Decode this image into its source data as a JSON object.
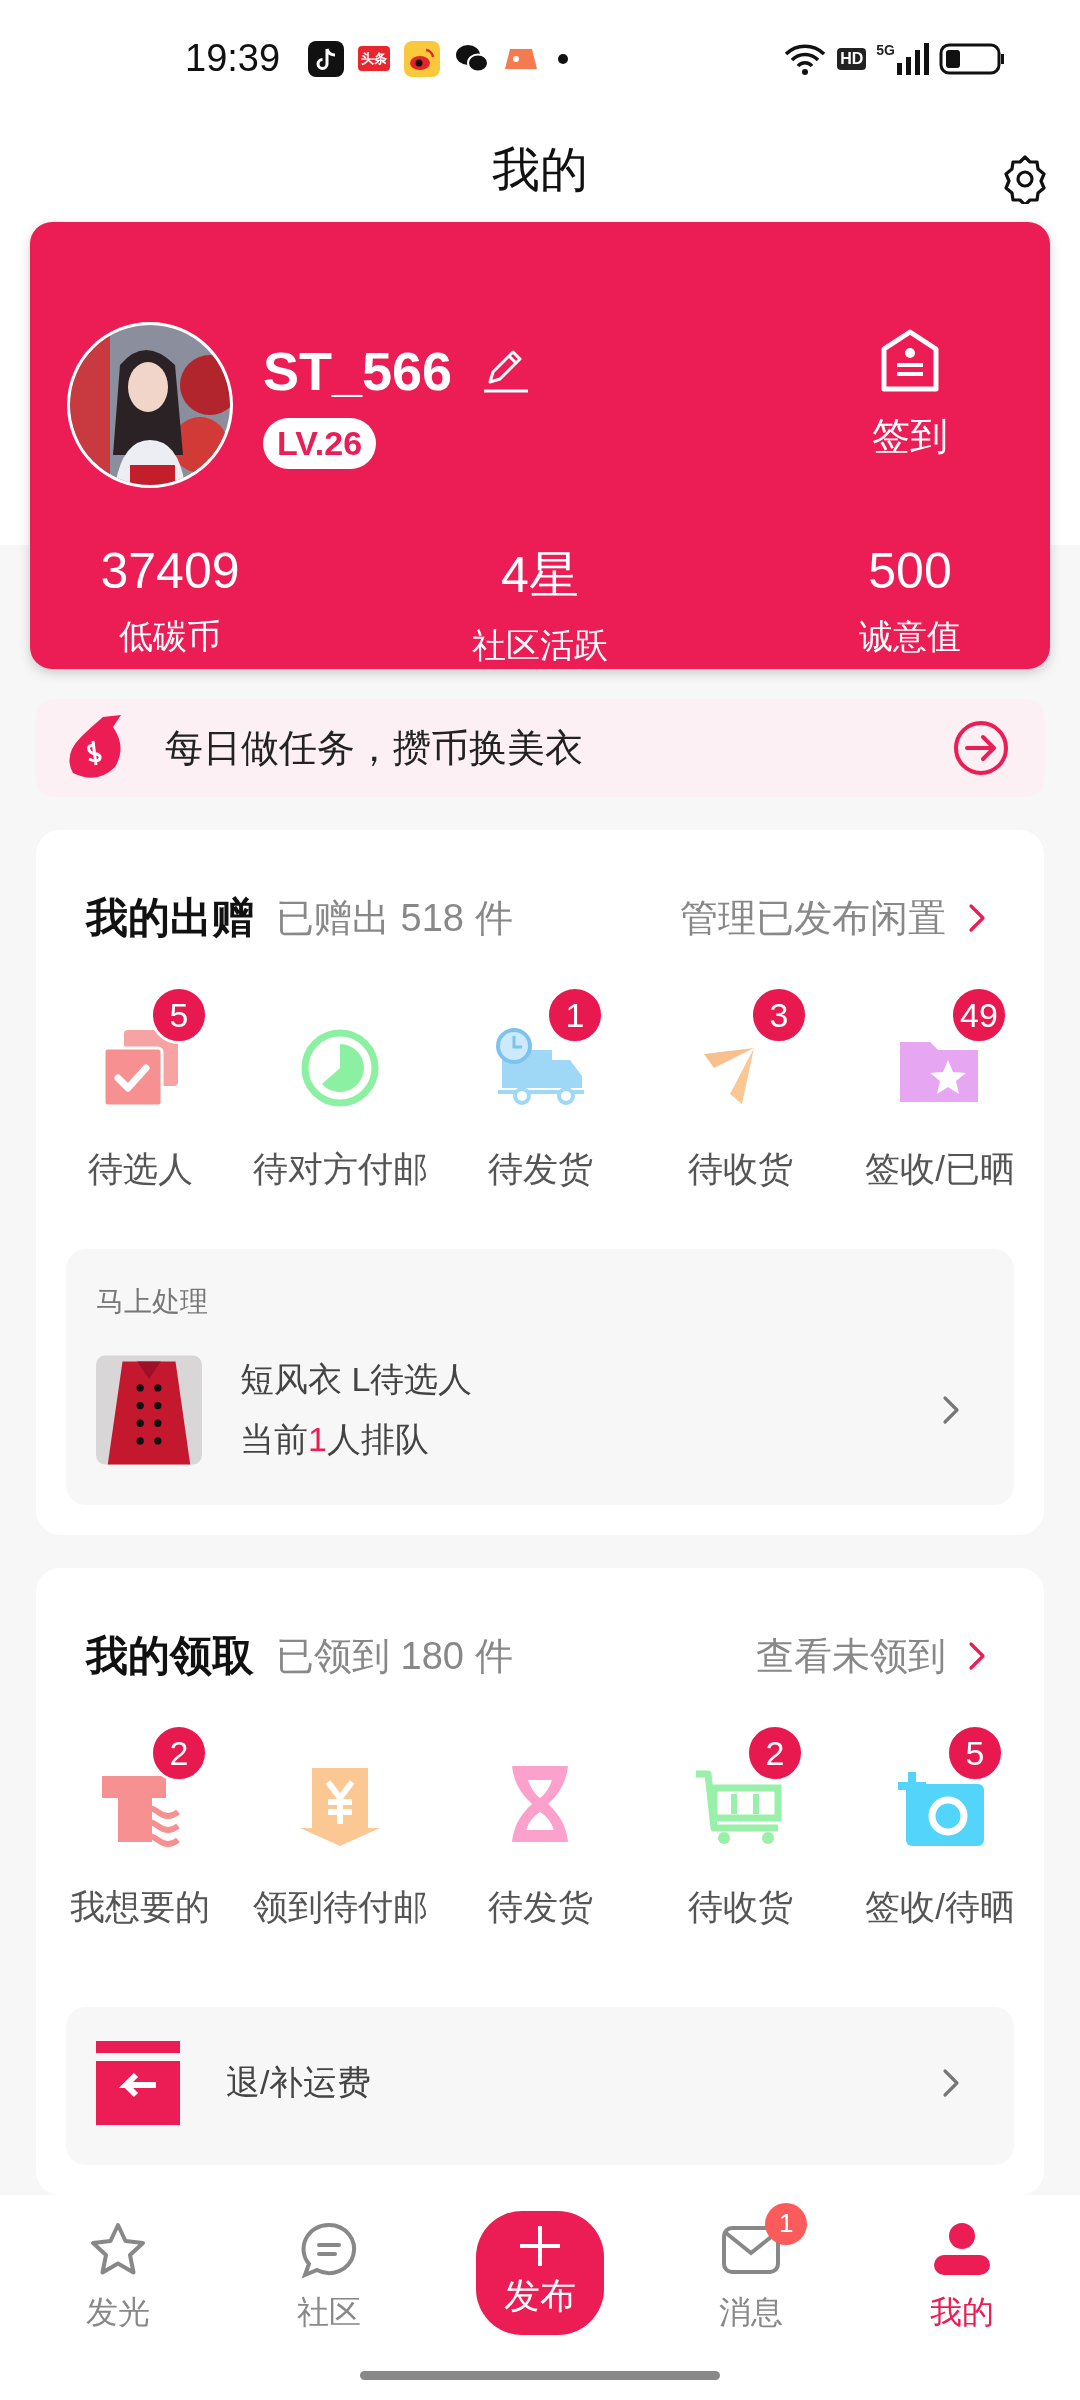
{
  "status_bar": {
    "time": "19:39",
    "news_app_label": "头条",
    "hd_badge": "HD",
    "network_type": "5G"
  },
  "header": {
    "title": "我的"
  },
  "profile": {
    "username": "ST_566",
    "level": "LV.26",
    "checkin_label": "签到",
    "stats": [
      {
        "value": "37409",
        "label": "低碳币"
      },
      {
        "value": "4星",
        "label": "社区活跃"
      },
      {
        "value": "500",
        "label": "诚意值"
      }
    ]
  },
  "banner": {
    "text": "每日做任务，攒币换美衣"
  },
  "sections": [
    {
      "title": "我的出赠",
      "summary": "已赠出 518 件",
      "link": "管理已发布闲置",
      "items": [
        {
          "kind": "clipboard",
          "label": "待选人",
          "badge": "5"
        },
        {
          "kind": "clock",
          "label": "待对方付邮"
        },
        {
          "kind": "truck",
          "label": "待发货",
          "badge": "1"
        },
        {
          "kind": "plane",
          "label": "待收货",
          "badge": "3"
        },
        {
          "kind": "folder",
          "label": "签收/已晒",
          "badge": "49"
        }
      ],
      "panel": {
        "heading": "马上处理",
        "rows": [
          {
            "kind": "pending",
            "title": "短风衣 L待选人",
            "queue_prefix": "当前",
            "queue_count": "1",
            "queue_suffix": "人排队"
          }
        ]
      }
    },
    {
      "title": "我的领取",
      "summary": "已领到 180 件",
      "link": "查看未领到",
      "items": [
        {
          "kind": "shirt",
          "label": "我想要的",
          "badge": "2"
        },
        {
          "kind": "yen",
          "label": "领到待付邮"
        },
        {
          "kind": "hourglass",
          "label": "待发货"
        },
        {
          "kind": "cart",
          "label": "待收货",
          "badge": "2"
        },
        {
          "kind": "camera",
          "label": "签收/待晒",
          "badge": "5"
        }
      ],
      "panel": {
        "rows": [
          {
            "kind": "refund",
            "title": "退/补运费"
          }
        ]
      }
    }
  ],
  "nav": [
    {
      "kind": "star",
      "label": "发光",
      "selected": false
    },
    {
      "kind": "chat",
      "label": "社区",
      "selected": false
    },
    {
      "kind": "publish",
      "label": "发布",
      "selected": false
    },
    {
      "kind": "mail",
      "label": "消息",
      "selected": false,
      "badge": "1"
    },
    {
      "kind": "person",
      "label": "我的",
      "selected": true
    }
  ]
}
